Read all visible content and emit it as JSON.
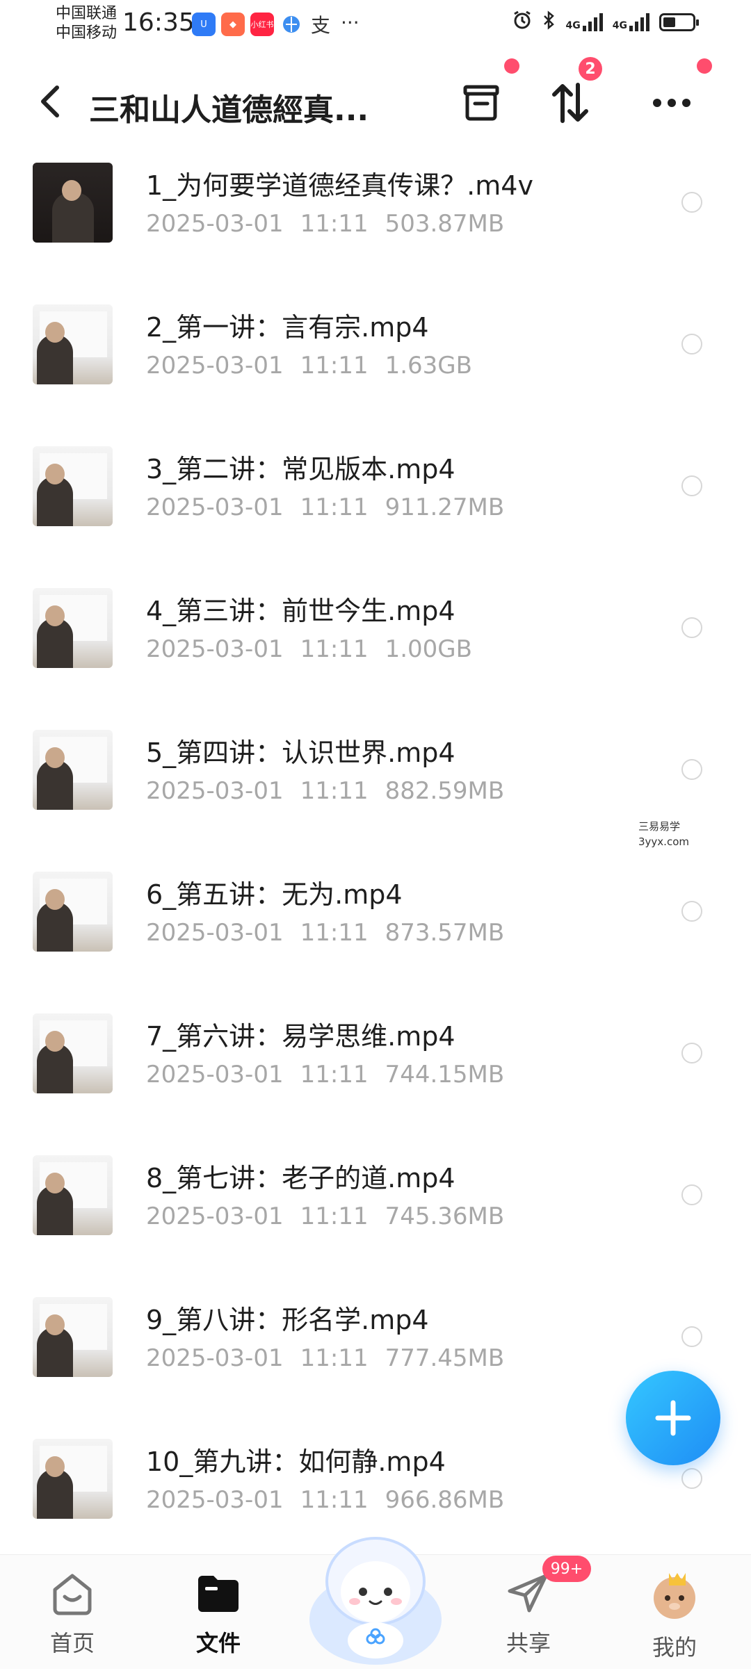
{
  "status_bar": {
    "carrier_1": "中国联通",
    "carrier_2": "中国移动",
    "time": "16:35",
    "app_icons": [
      "blue-app-icon",
      "orange-app-icon",
      "xiaohongshu-icon",
      "globe-app-icon",
      "alipay-icon"
    ],
    "more": "···",
    "net_1": "4G",
    "net_2": "4G",
    "battery_level": 0.4
  },
  "header": {
    "back_icon": "chevron-left-icon",
    "title": "三和山人道德經真...",
    "transfer_badge": "2"
  },
  "files": [
    {
      "name": "1_为何要学道德经真传课？.m4v",
      "date": "2025-03-01",
      "time": "11:11",
      "size": "503.87MB"
    },
    {
      "name": "2_第一讲：言有宗.mp4",
      "date": "2025-03-01",
      "time": "11:11",
      "size": "1.63GB"
    },
    {
      "name": "3_第二讲：常见版本.mp4",
      "date": "2025-03-01",
      "time": "11:11",
      "size": "911.27MB"
    },
    {
      "name": "4_第三讲：前世今生.mp4",
      "date": "2025-03-01",
      "time": "11:11",
      "size": "1.00GB"
    },
    {
      "name": "5_第四讲：认识世界.mp4",
      "date": "2025-03-01",
      "time": "11:11",
      "size": "882.59MB"
    },
    {
      "name": "6_第五讲：无为.mp4",
      "date": "2025-03-01",
      "time": "11:11",
      "size": "873.57MB"
    },
    {
      "name": "7_第六讲：易学思维.mp4",
      "date": "2025-03-01",
      "time": "11:11",
      "size": "744.15MB"
    },
    {
      "name": "8_第七讲：老子的道.mp4",
      "date": "2025-03-01",
      "time": "11:11",
      "size": "745.36MB"
    },
    {
      "name": "9_第八讲：形名学.mp4",
      "date": "2025-03-01",
      "time": "11:11",
      "size": "777.45MB"
    },
    {
      "name": "10_第九讲：如何静.mp4",
      "date": "2025-03-01",
      "time": "11:11",
      "size": "966.86MB"
    }
  ],
  "watermark": {
    "line1": "三易易学",
    "line2": "3yyx.com"
  },
  "fab": {
    "icon": "plus-icon"
  },
  "bottom_nav": {
    "home": "首页",
    "files": "文件",
    "share": "共享",
    "share_badge": "99+",
    "mine": "我的"
  },
  "colors": {
    "accent": "#1e8df5",
    "badge": "#ff4d6d",
    "meta_text": "#a7a7a7"
  }
}
